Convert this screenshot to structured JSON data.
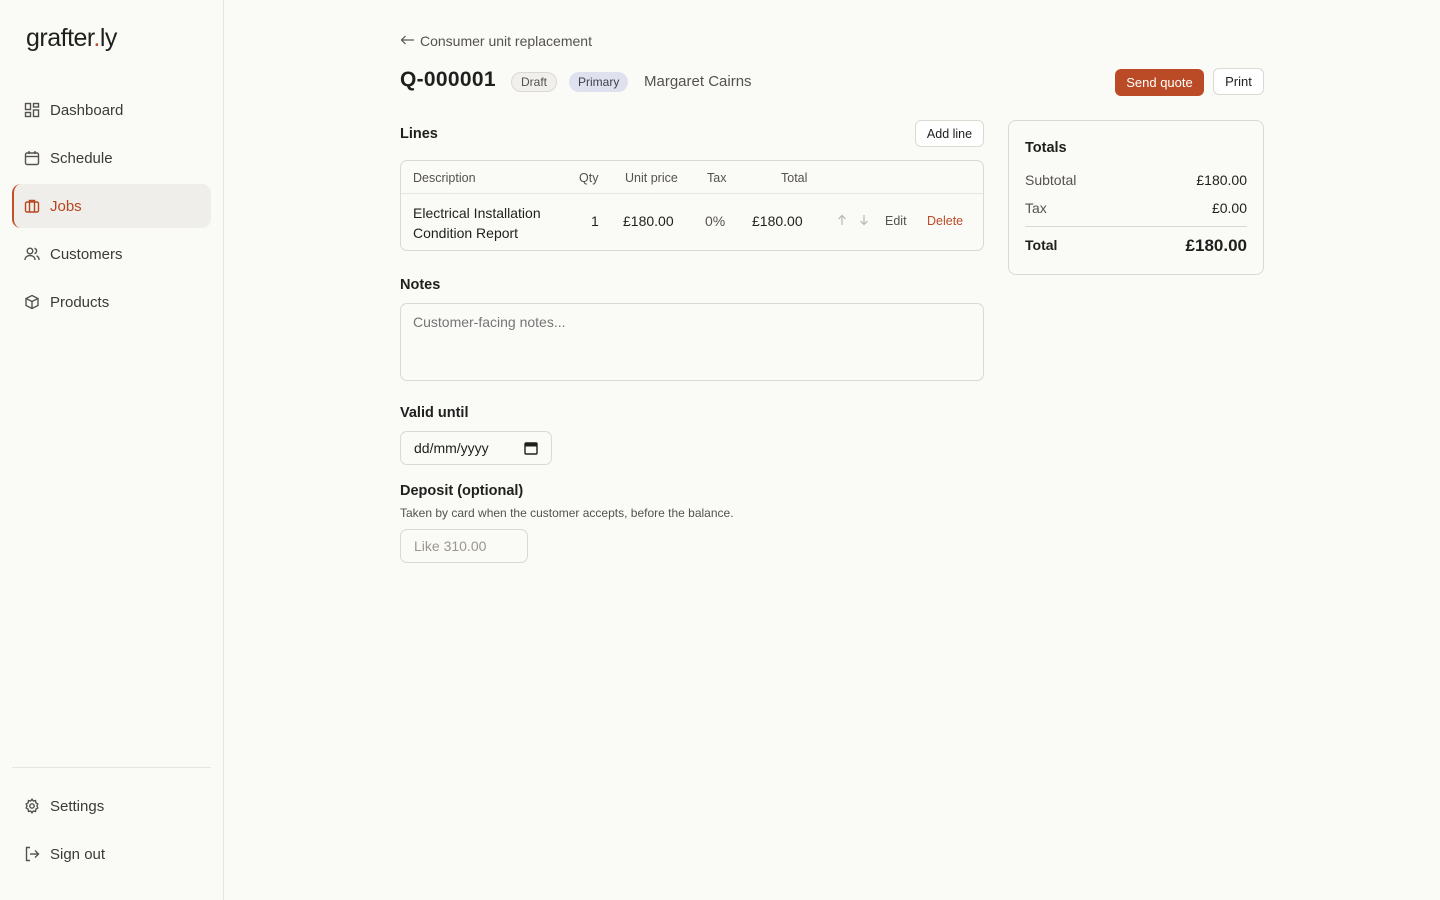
{
  "brand": {
    "name_main": "grafter",
    "name_dot": ".",
    "name_tail": "ly",
    "accent": "#c4502a"
  },
  "sidebar": {
    "items": [
      {
        "label": "Dashboard",
        "icon": "dashboard-icon"
      },
      {
        "label": "Schedule",
        "icon": "calendar-icon"
      },
      {
        "label": "Jobs",
        "icon": "briefcase-icon",
        "active": true
      },
      {
        "label": "Customers",
        "icon": "users-icon"
      },
      {
        "label": "Products",
        "icon": "box-icon"
      }
    ],
    "footer": [
      {
        "label": "Settings",
        "icon": "gear-icon"
      },
      {
        "label": "Sign out",
        "icon": "sign-out-icon"
      }
    ]
  },
  "header": {
    "back_label": "Consumer unit replacement",
    "quote_id": "Q-000001",
    "status_badge": "Draft",
    "primary_badge": "Primary",
    "customer": "Margaret Cairns",
    "send_label": "Send quote",
    "print_label": "Print"
  },
  "lines": {
    "title": "Lines",
    "add_label": "Add line",
    "columns": [
      "Description",
      "Qty",
      "Unit price",
      "Tax",
      "Total"
    ],
    "rows": [
      {
        "description": "Electrical Installation Condition Report",
        "qty": "1",
        "unit_price": "£180.00",
        "tax": "0%",
        "total": "£180.00",
        "edit": "Edit",
        "delete": "Delete"
      }
    ]
  },
  "notes": {
    "title": "Notes",
    "placeholder": "Customer-facing notes..."
  },
  "valid_until": {
    "title": "Valid until",
    "placeholder": "dd/mm/yyyy"
  },
  "deposit": {
    "title": "Deposit (optional)",
    "hint": "Taken by card when the customer accepts, before the balance.",
    "placeholder": "Like 310.00"
  },
  "totals": {
    "title": "Totals",
    "subtotal_label": "Subtotal",
    "subtotal": "£180.00",
    "tax_label": "Tax",
    "tax": "£0.00",
    "total_label": "Total",
    "total": "£180.00"
  }
}
